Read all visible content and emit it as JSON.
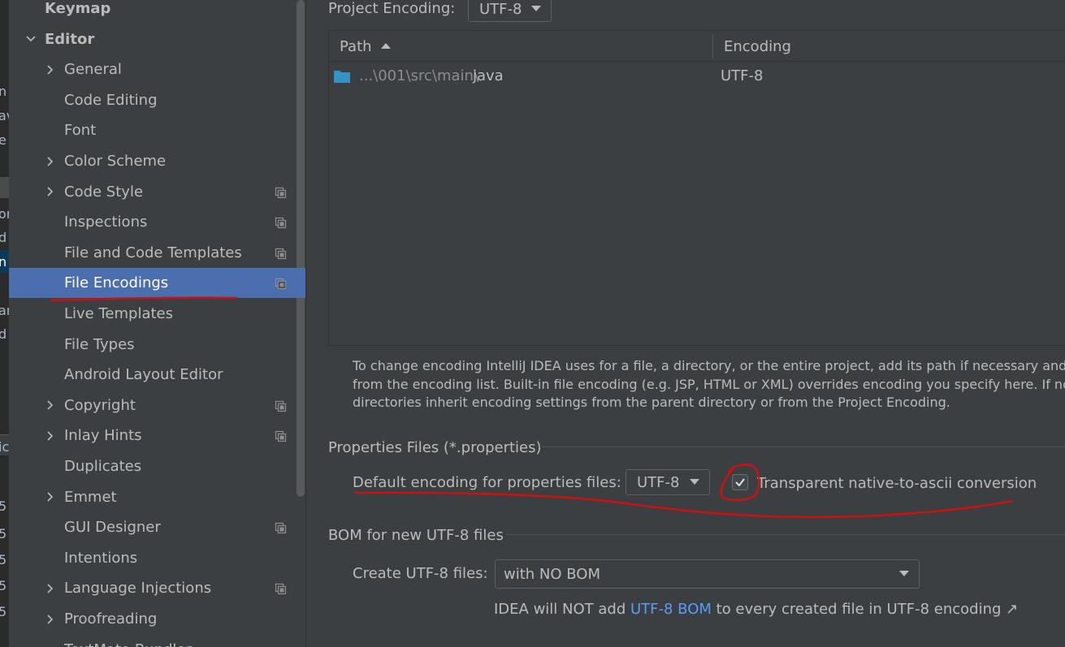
{
  "edge_fragments": [
    "n",
    "av",
    "e",
    "or",
    "d",
    "n",
    "ar",
    "d",
    "ic",
    "5",
    "5",
    "5",
    "5",
    "5"
  ],
  "sidebar": {
    "items": [
      {
        "label": "Keymap",
        "name": "sidebar-item-keymap",
        "chevron": "none",
        "bold": true
      },
      {
        "label": "Editor",
        "name": "sidebar-item-editor",
        "chevron": "down",
        "bold": true
      },
      {
        "label": "General",
        "name": "sidebar-item-general",
        "chevron": "right"
      },
      {
        "label": "Code Editing",
        "name": "sidebar-item-code-editing",
        "chevron": "none"
      },
      {
        "label": "Font",
        "name": "sidebar-item-font",
        "chevron": "none"
      },
      {
        "label": "Color Scheme",
        "name": "sidebar-item-color-scheme",
        "chevron": "right"
      },
      {
        "label": "Code Style",
        "name": "sidebar-item-code-style",
        "chevron": "right",
        "project": true
      },
      {
        "label": "Inspections",
        "name": "sidebar-item-inspections",
        "chevron": "none",
        "project": true
      },
      {
        "label": "File and Code Templates",
        "name": "sidebar-item-file-code-templates",
        "chevron": "none",
        "project": true
      },
      {
        "label": "File Encodings",
        "name": "sidebar-item-file-encodings",
        "chevron": "none",
        "project": true,
        "selected": true
      },
      {
        "label": "Live Templates",
        "name": "sidebar-item-live-templates",
        "chevron": "none"
      },
      {
        "label": "File Types",
        "name": "sidebar-item-file-types",
        "chevron": "none"
      },
      {
        "label": "Android Layout Editor",
        "name": "sidebar-item-android-layout-editor",
        "chevron": "none"
      },
      {
        "label": "Copyright",
        "name": "sidebar-item-copyright",
        "chevron": "right",
        "project": true
      },
      {
        "label": "Inlay Hints",
        "name": "sidebar-item-inlay-hints",
        "chevron": "right",
        "project": true
      },
      {
        "label": "Duplicates",
        "name": "sidebar-item-duplicates",
        "chevron": "none"
      },
      {
        "label": "Emmet",
        "name": "sidebar-item-emmet",
        "chevron": "right"
      },
      {
        "label": "GUI Designer",
        "name": "sidebar-item-gui-designer",
        "chevron": "none",
        "project": true
      },
      {
        "label": "Intentions",
        "name": "sidebar-item-intentions",
        "chevron": "none"
      },
      {
        "label": "Language Injections",
        "name": "sidebar-item-language-injections",
        "chevron": "right",
        "project": true
      },
      {
        "label": "Proofreading",
        "name": "sidebar-item-proofreading",
        "chevron": "right"
      },
      {
        "label": "TextMate Bundles",
        "name": "sidebar-item-textmate-bundles",
        "chevron": "none"
      }
    ]
  },
  "main": {
    "project_encoding_label": "Project Encoding:",
    "project_encoding_value": "UTF-8",
    "table": {
      "columns": [
        "Path",
        "Encoding"
      ],
      "rows": [
        {
          "path_prefix": "...\\001\\src\\main\\",
          "path_name": "java",
          "encoding": "UTF-8"
        }
      ]
    },
    "help_lines": [
      "To change encoding IntelliJ IDEA uses for a file, a directory, or the entire project, add its path if necessary and then",
      "from the encoding list. Built-in file encoding (e.g. JSP, HTML or XML) overrides encoding you specify here. If not spe",
      "directories inherit encoding settings from the parent directory or from the Project Encoding."
    ],
    "properties_section": "Properties Files (*.properties)",
    "default_encoding_label": "Default encoding for properties files:",
    "default_encoding_value": "UTF-8",
    "transparent_label": "Transparent native-to-ascii conversion",
    "transparent_checked": true,
    "bom_section": "BOM for new UTF-8 files",
    "create_label": "Create UTF-8 files:",
    "create_value": "with NO BOM",
    "bom_note_prefix": "IDEA will NOT add ",
    "bom_note_link": "UTF-8 BOM",
    "bom_note_suffix": " to every created file in UTF-8 encoding ↗"
  },
  "colors": {
    "background": "#3c3f41",
    "selection": "#4b6eaf",
    "link": "#589df6",
    "annotation": "#cc1111"
  }
}
